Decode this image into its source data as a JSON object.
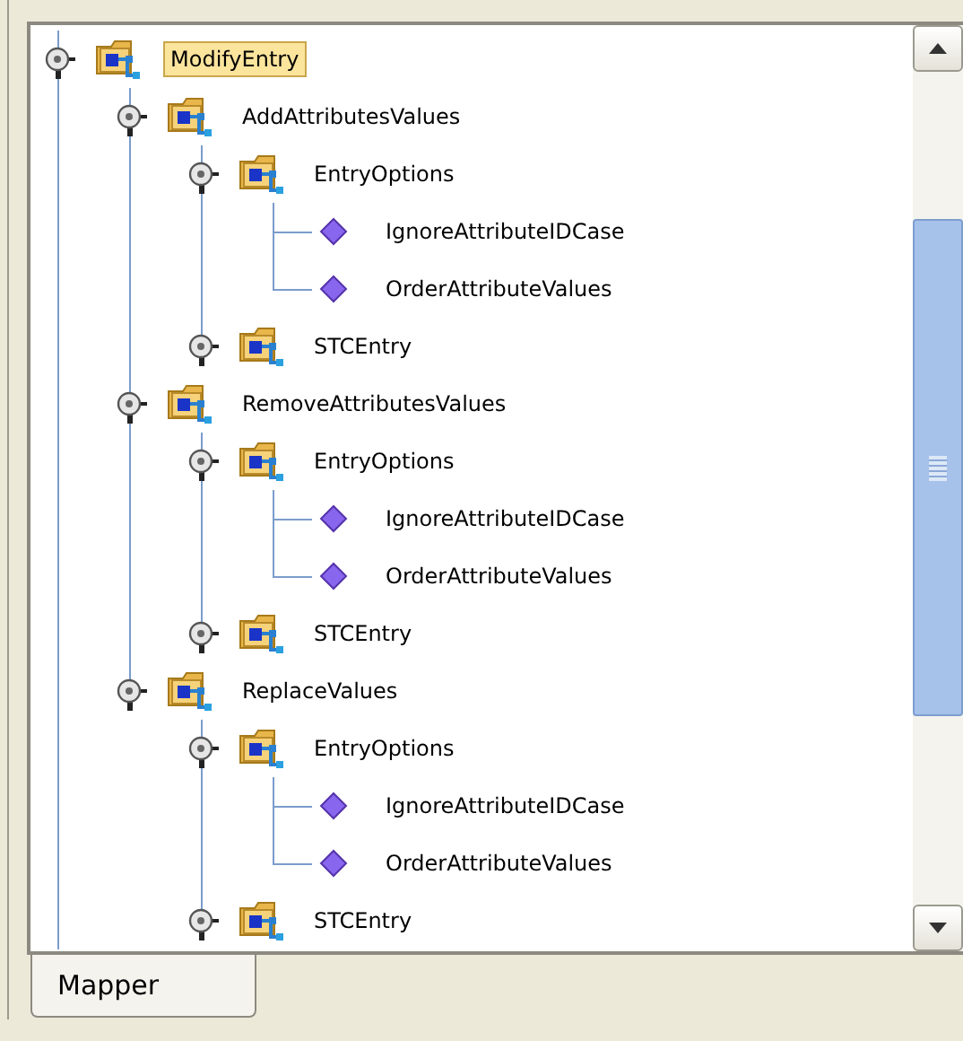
{
  "tree": [
    {
      "label": "ModifyEntry",
      "kind": "folder",
      "selected": true,
      "children": [
        {
          "label": "AddAttributesValues",
          "kind": "folder",
          "selected": false,
          "children": [
            {
              "label": "EntryOptions",
              "kind": "folder",
              "selected": false,
              "children": [
                {
                  "label": "IgnoreAttributeIDCase",
                  "kind": "attribute",
                  "selected": false
                },
                {
                  "label": "OrderAttributeValues",
                  "kind": "attribute",
                  "selected": false
                }
              ]
            },
            {
              "label": "STCEntry",
              "kind": "folder",
              "selected": false
            }
          ]
        },
        {
          "label": "RemoveAttributesValues",
          "kind": "folder",
          "selected": false,
          "children": [
            {
              "label": "EntryOptions",
              "kind": "folder",
              "selected": false,
              "children": [
                {
                  "label": "IgnoreAttributeIDCase",
                  "kind": "attribute",
                  "selected": false
                },
                {
                  "label": "OrderAttributeValues",
                  "kind": "attribute",
                  "selected": false
                }
              ]
            },
            {
              "label": "STCEntry",
              "kind": "folder",
              "selected": false
            }
          ]
        },
        {
          "label": "ReplaceValues",
          "kind": "folder",
          "selected": false,
          "children": [
            {
              "label": "EntryOptions",
              "kind": "folder",
              "selected": false,
              "children": [
                {
                  "label": "IgnoreAttributeIDCase",
                  "kind": "attribute",
                  "selected": false
                },
                {
                  "label": "OrderAttributeValues",
                  "kind": "attribute",
                  "selected": false
                }
              ]
            },
            {
              "label": "STCEntry",
              "kind": "folder",
              "selected": false
            }
          ]
        }
      ]
    }
  ],
  "tabs": [
    {
      "label": "Mapper",
      "selected": true
    }
  ]
}
